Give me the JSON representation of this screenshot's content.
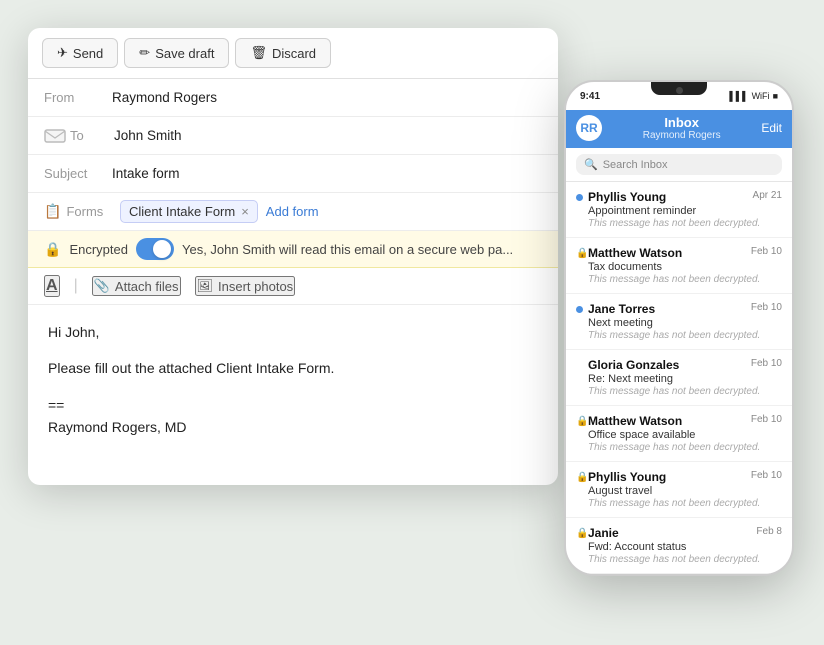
{
  "app": {
    "background_color": "#e8ede8"
  },
  "compose": {
    "toolbar": {
      "send_label": "Send",
      "save_draft_label": "Save draft",
      "discard_label": "Discard",
      "send_icon": "✈",
      "save_icon": "✏",
      "discard_icon": "🗑"
    },
    "fields": {
      "from_label": "From",
      "from_value": "Raymond Rogers",
      "to_label": "To",
      "to_value": "John Smith",
      "subject_label": "Subject",
      "subject_value": "Intake form",
      "forms_label": "Forms",
      "form_tag": "Client Intake Form",
      "form_close": "×",
      "add_form_link": "Add form"
    },
    "encrypted": {
      "label": "Encrypted",
      "message": "Yes, John Smith will read this email on a secure web pa...",
      "toggle_on": true
    },
    "format_bar": {
      "font_btn": "A",
      "attach_label": "Attach files",
      "photo_label": "Insert photos"
    },
    "body": {
      "line1": "Hi John,",
      "line2": "",
      "line3": "Please fill out the attached Client Intake Form.",
      "line4": "",
      "line5": "==",
      "line6": "Raymond Rogers, MD"
    }
  },
  "phone": {
    "status_time": "9:41",
    "status_signal": "▌▌▌",
    "status_wifi": "WiFi",
    "status_battery": "■",
    "header": {
      "title": "Inbox",
      "subtitle": "Raymond Rogers",
      "edit_label": "Edit",
      "avatar_initials": "RR"
    },
    "search": {
      "placeholder": "Search Inbox"
    },
    "emails": [
      {
        "sender": "Phyllis Young",
        "subject": "Appointment reminder",
        "preview": "This message has not been decrypted.",
        "date": "Apr 21",
        "unread": true,
        "locked": false
      },
      {
        "sender": "Matthew Watson",
        "subject": "Tax documents",
        "preview": "This message has not been decrypted.",
        "date": "Feb 10",
        "unread": false,
        "locked": true
      },
      {
        "sender": "Jane Torres",
        "subject": "Next meeting",
        "preview": "This message has not been decrypted.",
        "date": "Feb 10",
        "unread": true,
        "locked": false
      },
      {
        "sender": "Gloria Gonzales",
        "subject": "Re: Next meeting",
        "preview": "This message has not been decrypted.",
        "date": "Feb 10",
        "unread": false,
        "locked": false
      },
      {
        "sender": "Matthew Watson",
        "subject": "Office space available",
        "preview": "This message has not been decrypted.",
        "date": "Feb 10",
        "unread": false,
        "locked": true
      },
      {
        "sender": "Phyllis Young",
        "subject": "August travel",
        "preview": "This message has not been decrypted.",
        "date": "Feb 10",
        "unread": false,
        "locked": true
      },
      {
        "sender": "Janie",
        "subject": "Fwd: Account status",
        "preview": "This message has not been decrypted.",
        "date": "Feb 8",
        "unread": false,
        "locked": true
      }
    ]
  }
}
